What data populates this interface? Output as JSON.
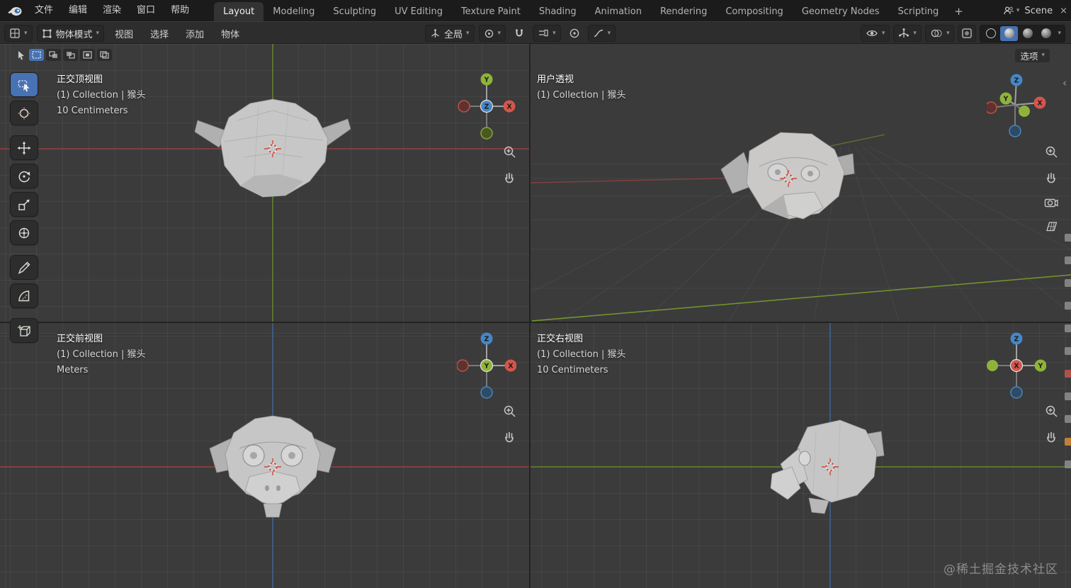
{
  "topbar": {
    "menus": [
      "文件",
      "编辑",
      "渲染",
      "窗口",
      "帮助"
    ],
    "tabs": [
      "Layout",
      "Modeling",
      "Sculpting",
      "UV Editing",
      "Texture Paint",
      "Shading",
      "Animation",
      "Rendering",
      "Compositing",
      "Geometry Nodes",
      "Scripting"
    ],
    "active_tab": "Layout",
    "add_tab": "+",
    "scene_selector": {
      "label": "Scene",
      "close": "×"
    }
  },
  "header": {
    "mode_select": "物体模式",
    "menus": [
      "视图",
      "选择",
      "添加",
      "物体"
    ],
    "orientation_select": "全局"
  },
  "viewport_bar": {
    "options_label": "选项"
  },
  "viewports": {
    "top_left": {
      "title": "正交顶视图",
      "collection": "(1) Collection | 猴头",
      "unit": "10 Centimeters"
    },
    "top_right": {
      "title": "用户透视",
      "collection": "(1) Collection | 猴头",
      "unit": ""
    },
    "bottom_left": {
      "title": "正交前视图",
      "collection": "(1) Collection | 猴头",
      "unit": "Meters"
    },
    "bottom_right": {
      "title": "正交右视图",
      "collection": "(1) Collection | 猴头",
      "unit": "10 Centimeters"
    }
  },
  "axis": {
    "x": "X",
    "y": "Y",
    "z": "Z"
  },
  "glyphs": {
    "caret": "▾",
    "collapse_left": "‹"
  },
  "colors": {
    "accent": "#4772b3",
    "axis_x": "#d4564a",
    "axis_y": "#8fb33a",
    "axis_z": "#4487c8"
  },
  "watermark": "@稀土掘金技术社区"
}
